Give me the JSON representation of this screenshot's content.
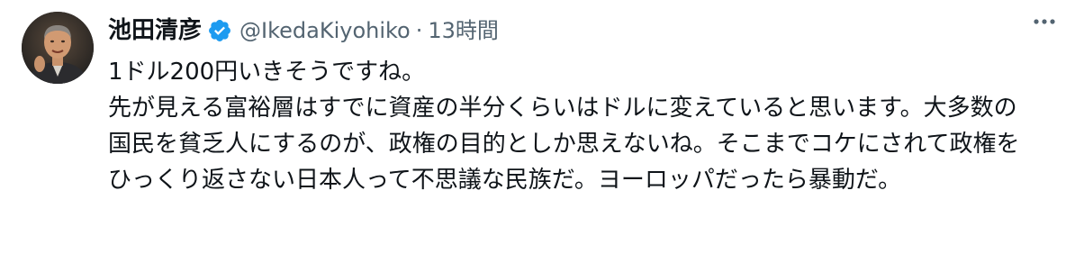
{
  "tweet": {
    "author": {
      "display_name": "池田清彦",
      "handle": "@IkedaKiyohiko",
      "verified_icon": "verified-badge-icon"
    },
    "separator": "·",
    "timestamp": "13時間",
    "more_icon": "more-horizontal-icon",
    "text": {
      "line1": "1ドル200円いきそうですね。",
      "paragraph": "先が見える富裕層はすでに資産の半分くらいはドルに変えていると思います。大多数の国民を貧乏人にするのが、政権の目的としか思えないね。そこまでコケにされて政権をひっくり返さない日本人って不思議な民族だ。ヨーロッパだったら暴動だ。"
    },
    "colors": {
      "verified_blue": "#1d9bf0",
      "secondary_text": "#536471",
      "primary_text": "#0f1419"
    }
  }
}
